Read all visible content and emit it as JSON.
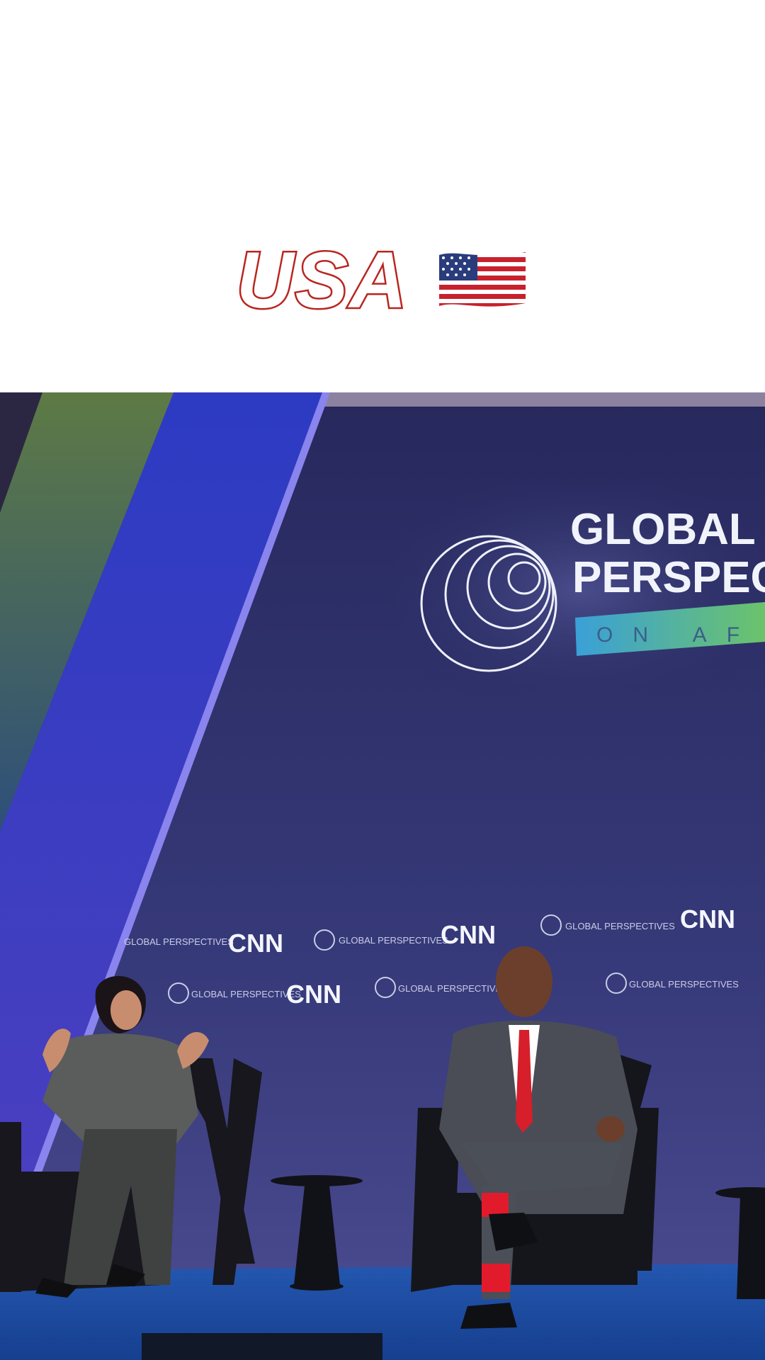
{
  "caption": {
    "text": "USA",
    "flag_icon": "us-flag-icon",
    "text_color": "#ffffff",
    "outline_color": "#b8261f"
  },
  "photo": {
    "logo": {
      "line1": "GLOBAL",
      "line2": "PERSPEC",
      "tagline": "ON AF"
    },
    "sponsor_logo": "CNN",
    "sponsor_small": "GLOBAL PERSPECTIVES",
    "colors": {
      "backdrop": "#2f2f6b",
      "stage_floor": "#1d4fa6",
      "accent_stripe": "#3b46c8",
      "green_stripe": "#5e7a4a"
    }
  }
}
